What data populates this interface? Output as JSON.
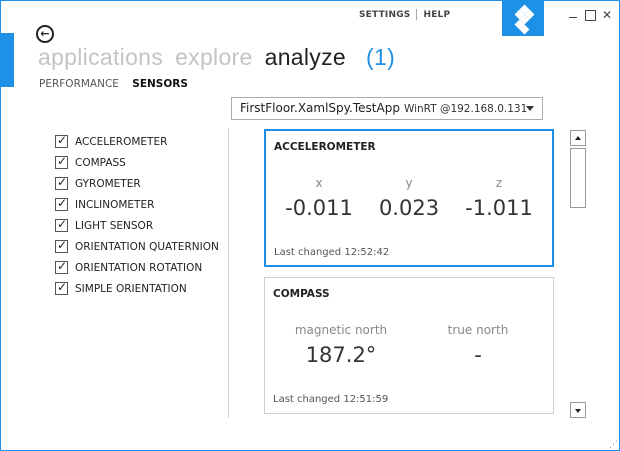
{
  "window": {
    "links": [
      "SETTINGS",
      "HELP"
    ],
    "controls": {
      "minimize": "minimize-icon",
      "maximize": "maximize-icon",
      "close": "close-icon"
    },
    "accent_color": "#1e90e6"
  },
  "nav": {
    "items": [
      "applications",
      "explore",
      "analyze"
    ],
    "active": "analyze",
    "count": "(1)"
  },
  "subtabs": {
    "items": [
      "PERFORMANCE",
      "SENSORS"
    ],
    "active": "SENSORS"
  },
  "target": {
    "app": "FirstFloor.XamlSpy.TestApp",
    "platform": "WinRT @192.168.0.131"
  },
  "sensors": [
    {
      "label": "ACCELEROMETER",
      "checked": true
    },
    {
      "label": "COMPASS",
      "checked": true
    },
    {
      "label": "GYROMETER",
      "checked": true
    },
    {
      "label": "INCLINOMETER",
      "checked": true
    },
    {
      "label": "LIGHT SENSOR",
      "checked": true
    },
    {
      "label": "ORIENTATION QUATERNION",
      "checked": true
    },
    {
      "label": "ORIENTATION ROTATION",
      "checked": true
    },
    {
      "label": "SIMPLE ORIENTATION",
      "checked": true
    }
  ],
  "cards": {
    "accelerometer": {
      "title": "ACCELEROMETER",
      "axes": [
        {
          "label": "x",
          "value": "-0.011"
        },
        {
          "label": "y",
          "value": "0.023"
        },
        {
          "label": "z",
          "value": "-1.011"
        }
      ],
      "last_changed": "Last changed 12:52:42"
    },
    "compass": {
      "title": "COMPASS",
      "readings": [
        {
          "label": "magnetic north",
          "value": "187.2°"
        },
        {
          "label": "true north",
          "value": "-"
        }
      ],
      "last_changed": "Last changed 12:51:59"
    }
  }
}
